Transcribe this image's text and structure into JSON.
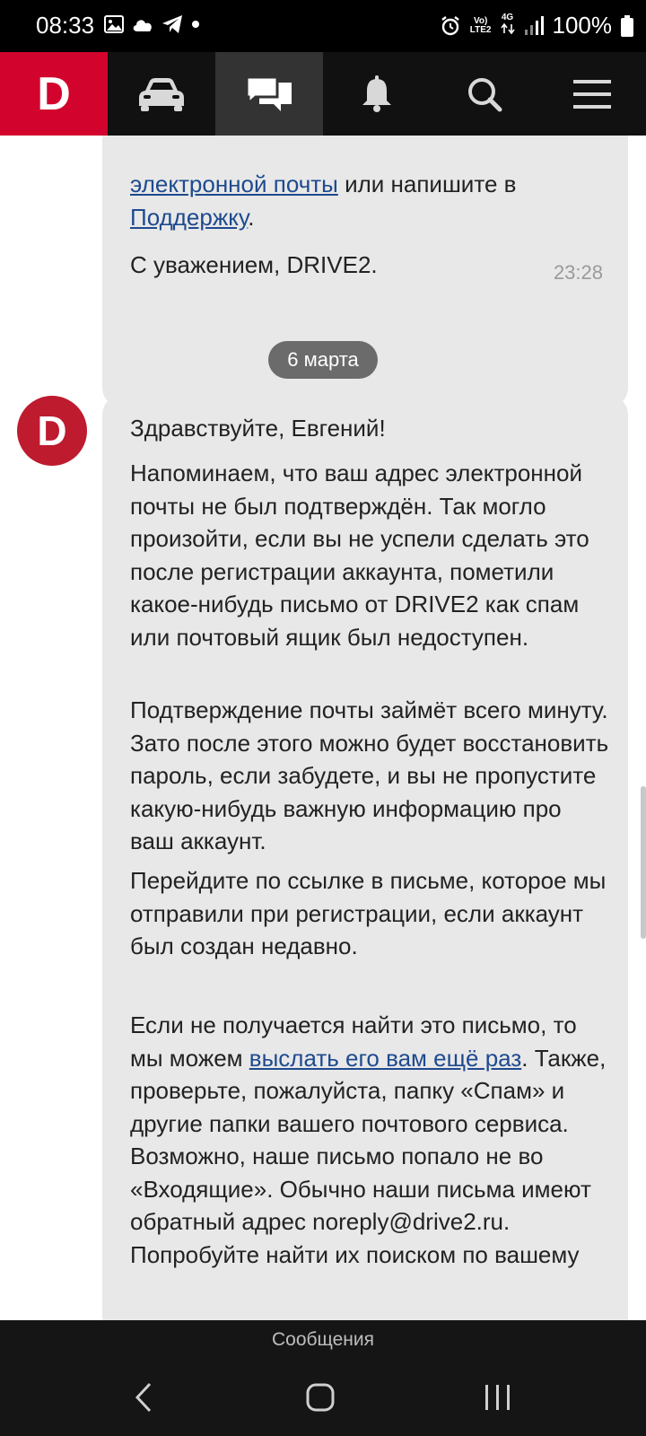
{
  "status": {
    "time": "08:33",
    "network_top": "Vo)",
    "network_bottom": "LTE2",
    "cell_label": "4G",
    "battery": "100%"
  },
  "nav": {
    "logo": "D",
    "items": [
      "car-icon",
      "messages-icon",
      "bell-icon",
      "search-icon",
      "menu-icon"
    ],
    "active_color": "#333333",
    "brand_color": "#d2042d"
  },
  "message1": {
    "link_line": "электронной почты",
    "after_link": " или напишите в",
    "support_link": "Поддержку",
    "support_tail": ".",
    "signature": "С уважением, DRIVE2.",
    "time": "23:28"
  },
  "date_chip": "6 марта",
  "avatar_letter": "D",
  "message2": {
    "greeting": "Здравствуйте, Евгений!",
    "p1": "Напоминаем, что ваш адрес электронной почты не был подтверждён. Так могло произойти, если вы не успели сделать это после регистрации аккаунта, пометили какое-нибудь письмо от DRIVE2 как спам или почтовый ящик был недоступен.",
    "p2": "Подтверждение почты займёт всего минуту. Зато после этого можно будет восстановить пароль, если забудете, и вы не пропустите какую-нибудь важную информацию про ваш аккаунт.",
    "p3": "Перейдите по ссылке в письме, которое мы отправили при регистрации, если аккаунт был создан недавно.",
    "p4_start": "Если не получается найти это письмо, то мы можем ",
    "p4_link": "выслать его вам ещё раз",
    "p4_end": ". Также, проверьте, пожалуйста, папку «Спам» и другие папки вашего почтового сервиса. Возможно, наше письмо попало не во «Входящие». Обычно наши письма имеют обратный адрес noreply@drive2.ru. Попробуйте найти их поиском по вашему"
  },
  "caption": "Сообщения",
  "colors": {
    "link": "#1e4a8f",
    "bubble": "#e8e8e8",
    "avatar": "#be1b2f"
  }
}
